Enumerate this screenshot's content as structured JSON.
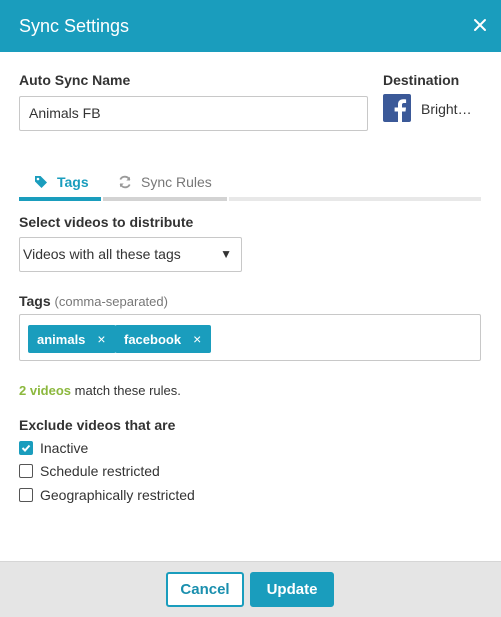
{
  "dialog": {
    "title": "Sync Settings",
    "close_icon": "close-icon"
  },
  "auto_sync": {
    "label": "Auto Sync Name",
    "value": "Animals FB"
  },
  "destination": {
    "label": "Destination",
    "value": "Bright…",
    "icon": "facebook-icon"
  },
  "tabs": [
    {
      "label": "Tags",
      "icon": "tag-icon",
      "active": true
    },
    {
      "label": "Sync Rules",
      "icon": "refresh-icon",
      "active": false
    }
  ],
  "select": {
    "label": "Select videos to distribute",
    "value": "Videos with all these tags",
    "arrow": "▼"
  },
  "tags": {
    "label": "Tags",
    "hint": "(comma-separated)",
    "items": [
      "animals",
      "facebook"
    ],
    "remove_glyph": "×"
  },
  "match": {
    "count": "2 videos",
    "text": " match these rules."
  },
  "exclude": {
    "label": "Exclude videos that are",
    "options": [
      {
        "label": "Inactive",
        "checked": true
      },
      {
        "label": "Schedule restricted",
        "checked": false
      },
      {
        "label": "Geographically restricted",
        "checked": false
      }
    ]
  },
  "footer": {
    "cancel_label": "Cancel",
    "update_label": "Update"
  },
  "colors": {
    "accent": "#1a9dbd",
    "match_green": "#8cb83e",
    "facebook_blue": "#3b5998",
    "footer_bg": "#e5e5e5"
  }
}
